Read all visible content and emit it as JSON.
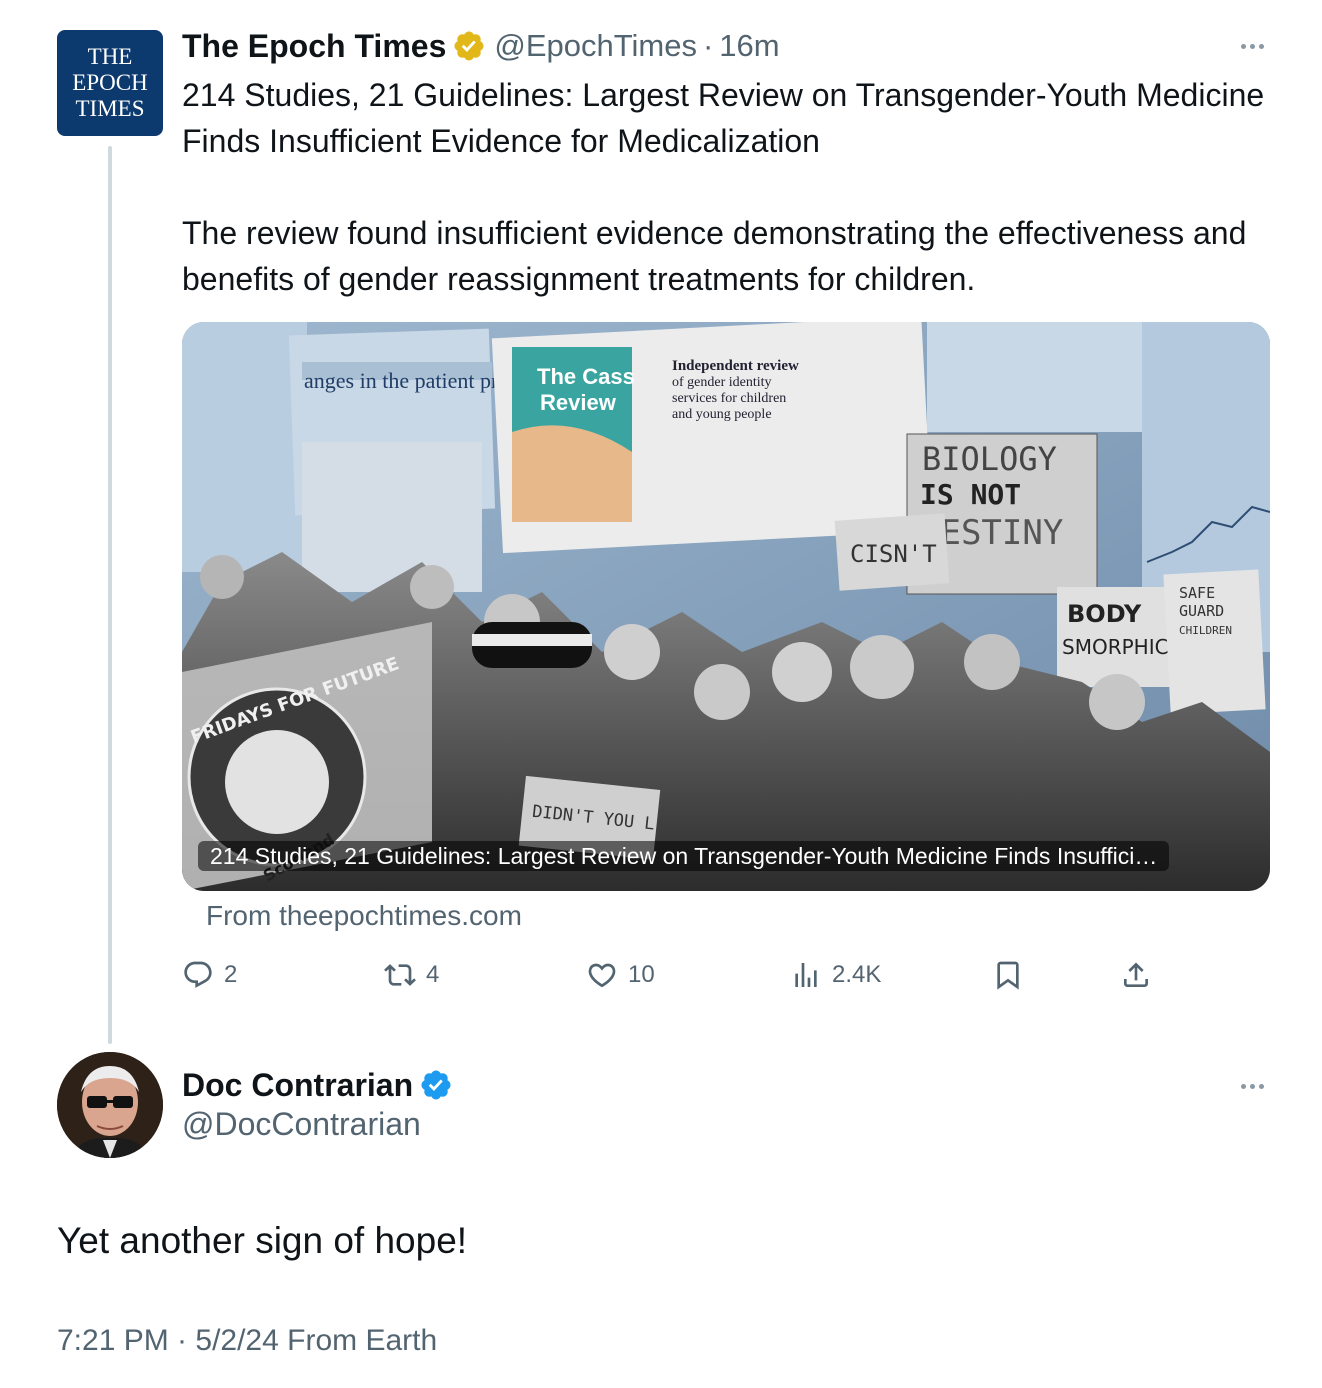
{
  "parent_tweet": {
    "avatar_text": [
      "THE",
      "EPOCH",
      "TIMES"
    ],
    "display_name": "The Epoch Times",
    "verified_badge": "gold-verified-badge",
    "handle": "@EpochTimes",
    "separator": "·",
    "time_ago": "16m",
    "text": "214 Studies, 21 Guidelines: Largest Review on Transgender-Youth Medicine Finds Insufficient Evidence for Medicalization\n\nThe review found insufficient evidence demonstrating the effectiveness and benefits of gender reassignment treatments for children.",
    "card": {
      "caption": "214 Studies, 21 Guidelines: Largest Review on Transgender-Youth Medicine Finds Insuffici…",
      "source": "From theepochtimes.com",
      "image_texts": {
        "cass_title_1": "The Cass",
        "cass_title_2": "Review",
        "review_1": "Independent review",
        "review_2": "of gender identity",
        "review_3": "services for children",
        "review_4": "and young people",
        "doc_heading": "anges in the patient pr",
        "sign_biology_1": "BIOLOGY",
        "sign_biology_2": "IS NOT",
        "sign_biology_3": "DESTINY",
        "sign_isnt": "CISN'T",
        "sign_body": "BODY",
        "sign_dysmorphic": "SMORPHIC",
        "sign_safe_1": "SAFE",
        "sign_safe_2": "GUARD",
        "sign_safe_3": "CHILDREN",
        "sign_didnt": "DIDN'T YOU L",
        "banner_fff": "FRIDAYS FOR FUTURE",
        "banner_scotland": "Scotland"
      }
    },
    "actions": {
      "reply_count": "2",
      "repost_count": "4",
      "like_count": "10",
      "views_count": "2.4K"
    }
  },
  "reply_tweet": {
    "display_name": "Doc Contrarian",
    "verified_badge": "blue-verified-badge",
    "handle": "@DocContrarian",
    "text": "Yet another sign of hope!",
    "meta": "7:21 PM · 5/2/24 From Earth"
  },
  "colors": {
    "text_primary": "#0f1419",
    "text_secondary": "#536471",
    "verified_blue": "#1d9bf0",
    "verified_gold": "#e2b719",
    "epoch_blue": "#0d3a6e",
    "thread_line": "#cfd9de"
  }
}
